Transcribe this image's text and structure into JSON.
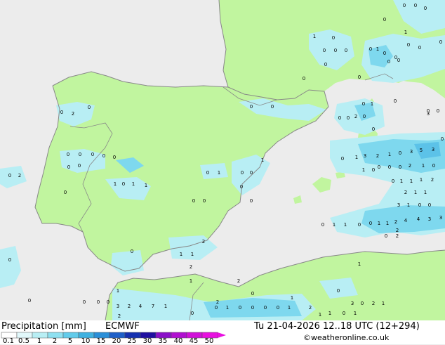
{
  "map": {
    "colors": {
      "sea": "#ececec",
      "land": "#c1f59f",
      "coast": "#888888",
      "precip_light": "#b8eef4",
      "precip_mid": "#7ed8ee",
      "precip_high": "#5cc2e8"
    },
    "point_values": [
      "0",
      "2",
      "0",
      "0",
      "0",
      "0",
      "0",
      "0",
      "0",
      "0",
      "0",
      "0",
      "0",
      "2",
      "0",
      "0",
      "1",
      "0",
      "0",
      "0",
      "0",
      "0",
      "0",
      "0",
      "0",
      "1",
      "0",
      "0",
      "0",
      "0",
      "0",
      "1",
      "0",
      "0",
      "0",
      "0",
      "0",
      "0",
      "1",
      "0",
      "2",
      "0",
      "0",
      "0",
      "0",
      "0",
      "0",
      "1",
      "0",
      "0",
      "0",
      "1",
      "0",
      "0",
      "0",
      "0",
      "1",
      "0",
      "1",
      "1",
      "0",
      "1",
      "3",
      "2",
      "1",
      "0",
      "3",
      "5",
      "3",
      "0",
      "0",
      "0",
      "0",
      "2",
      "1",
      "0",
      "1",
      "0",
      "0",
      "1",
      "1",
      "1",
      "2",
      "2",
      "1",
      "1",
      "3",
      "1",
      "0",
      "0",
      "0",
      "1",
      "1",
      "2",
      "4",
      "4",
      "3",
      "3",
      "0",
      "1",
      "1",
      "0",
      "0",
      "2",
      "0",
      "1",
      "1",
      "2",
      "2",
      "1",
      "2",
      "0",
      "0",
      "1",
      "2",
      "4",
      "7",
      "1",
      "3",
      "0",
      "1",
      "0",
      "0",
      "0",
      "0",
      "1",
      "0",
      "0",
      "3",
      "0",
      "2",
      "1",
      "1",
      "2",
      "3",
      "2",
      "0",
      "1",
      "2",
      "1",
      "1",
      "0",
      "1",
      "0",
      "0",
      "0",
      "2"
    ]
  },
  "footer": {
    "title": "Precipitation [mm]",
    "model": "ECMWF",
    "datetime": "Tu 21-04-2026 12..18 UTC (12+294)",
    "credit": "©weatheronline.co.uk",
    "legend": {
      "ticks": [
        "0.1",
        "0.5",
        "1",
        "2",
        "5",
        "10",
        "15",
        "20",
        "25",
        "30",
        "35",
        "40",
        "45",
        "50"
      ],
      "colors": [
        "#ffffff",
        "#e2f8fb",
        "#b8eef4",
        "#8ee0f0",
        "#62cbea",
        "#3fb1e0",
        "#2a8fd8",
        "#1e5fc8",
        "#1530b0",
        "#2010a0",
        "#8a10c8",
        "#b010d0",
        "#d010d8",
        "#e810e0"
      ]
    }
  }
}
